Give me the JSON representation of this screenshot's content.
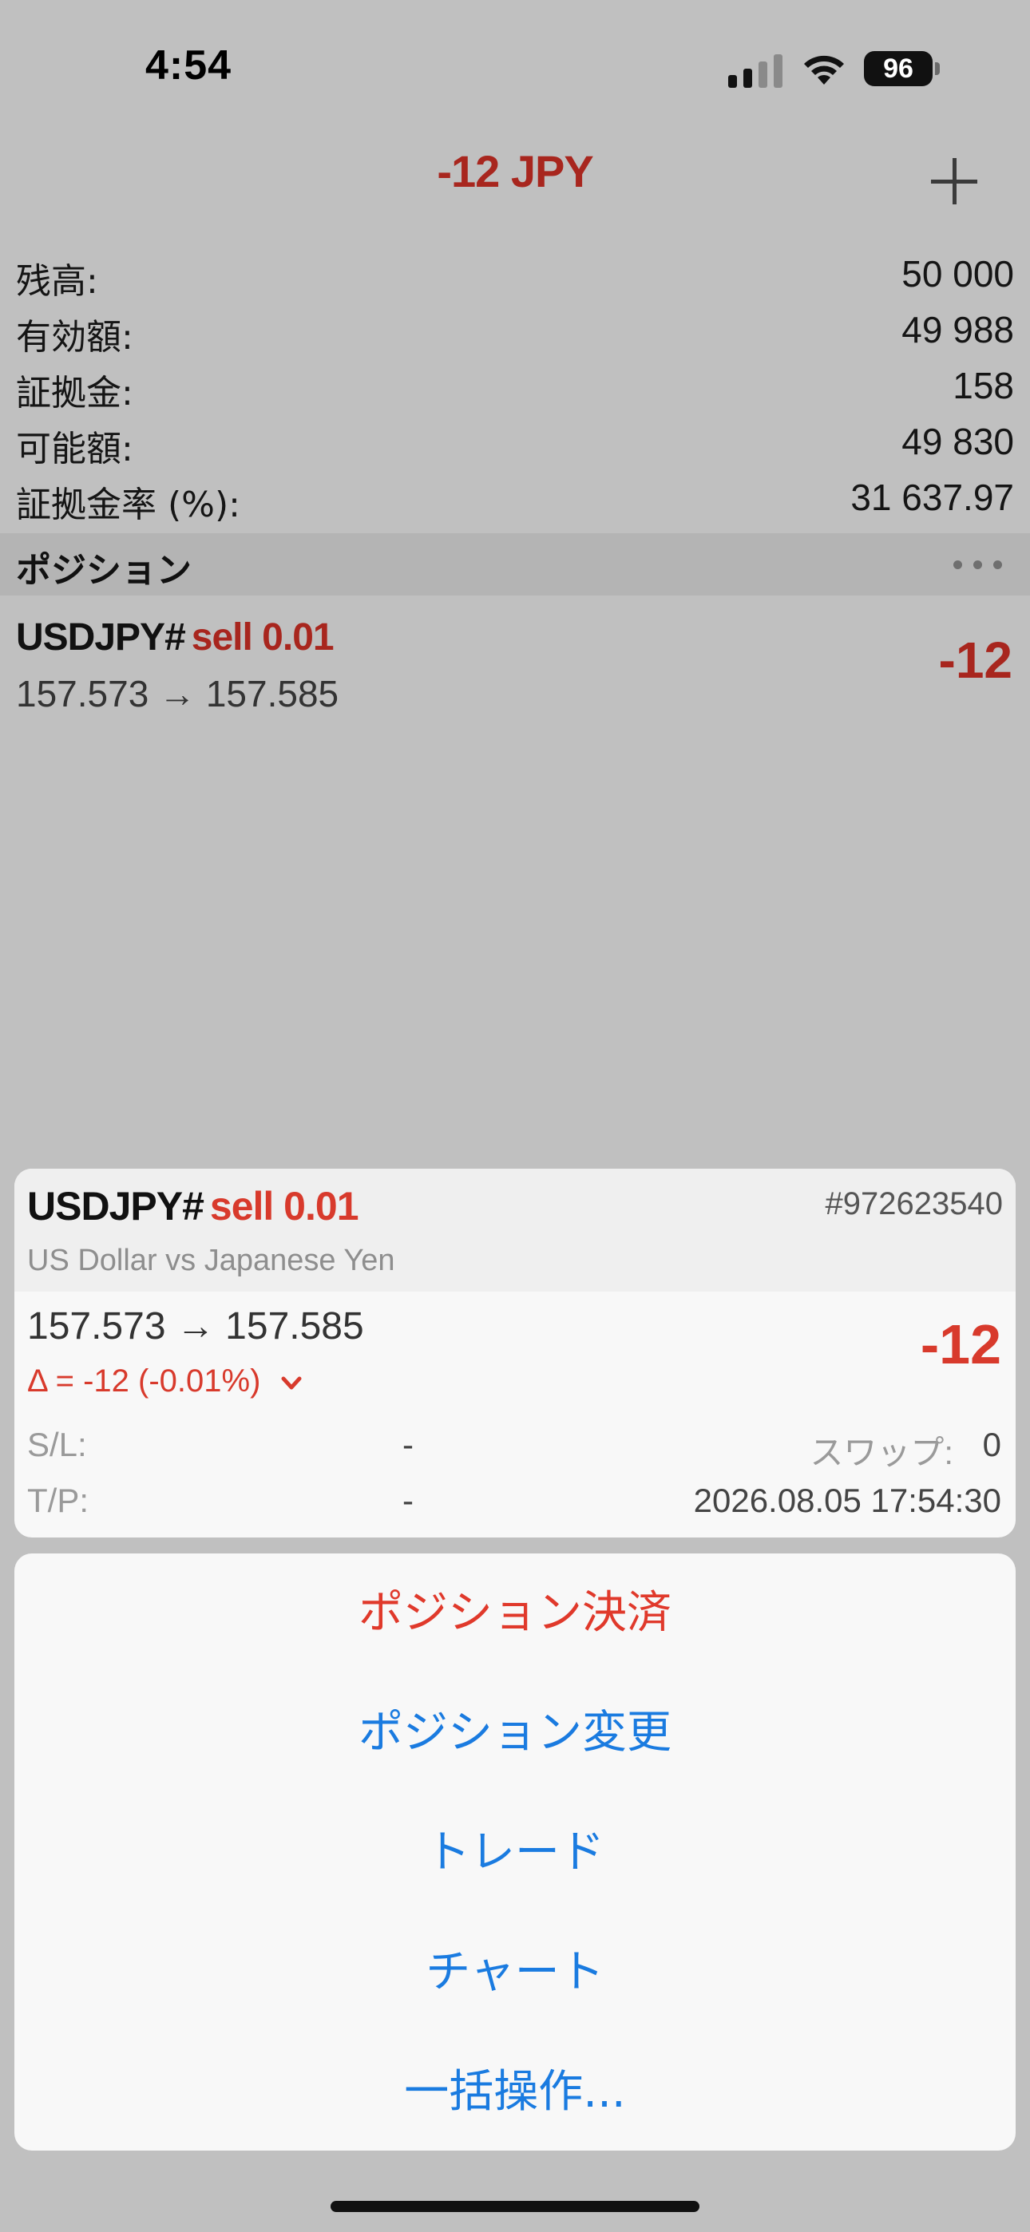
{
  "status_bar": {
    "time": "4:54",
    "battery": "96"
  },
  "header": {
    "total": "-12 JPY"
  },
  "summary": [
    {
      "label": "残高:",
      "value": "50 000"
    },
    {
      "label": "有効額:",
      "value": "49 988"
    },
    {
      "label": "証拠金:",
      "value": "158"
    },
    {
      "label": "可能額:",
      "value": "49 830"
    },
    {
      "label": "証拠金率 (%):",
      "value": "31 637.97"
    }
  ],
  "positions_section": {
    "title": "ポジション"
  },
  "position": {
    "symbol": "USDJPY#",
    "side": "sell 0.01",
    "prices": "157.573 → 157.585",
    "profit": "-12"
  },
  "detail": {
    "symbol": "USDJPY#",
    "side": "sell 0.01",
    "ticket": "#972623540",
    "description": "US Dollar vs Japanese Yen",
    "prices": "157.573 → 157.585",
    "profit": "-12",
    "delta": "Δ = -12 (-0.01%)",
    "sl_label": "S/L:",
    "sl_value": "-",
    "tp_label": "T/P:",
    "tp_value": "-",
    "swap_label": "スワップ:",
    "swap_value": "0",
    "open_time": "2026.08.05 17:54:30"
  },
  "actions": {
    "close_position": "ポジション決済",
    "modify_position": "ポジション変更",
    "trade": "トレード",
    "chart": "チャート",
    "bulk_operations": "一括操作..."
  },
  "colors": {
    "loss": "#a8261e",
    "loss_bright": "#d83a2c",
    "action_blue": "#1a7be0",
    "destructive": "#e0392b"
  }
}
